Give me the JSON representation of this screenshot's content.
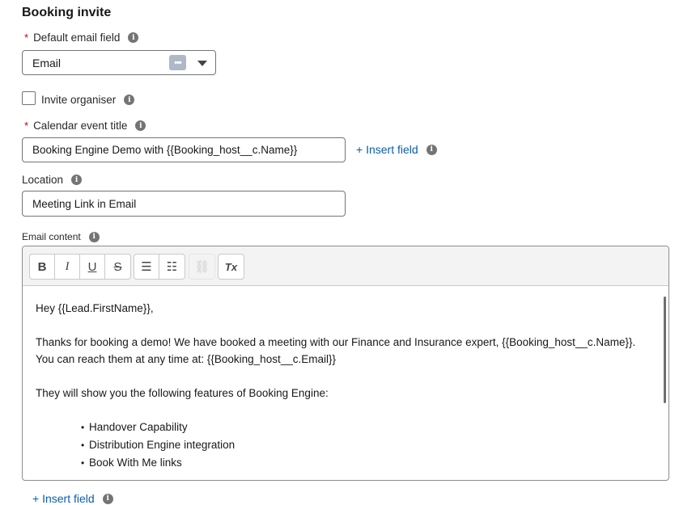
{
  "section": {
    "title": "Booking invite"
  },
  "default_email": {
    "required_marker": "*",
    "label": "Default email field",
    "value": "Email",
    "dots_icon": "•••"
  },
  "invite_organiser": {
    "label": "Invite organiser",
    "checked": false
  },
  "calendar_title": {
    "required_marker": "*",
    "label": "Calendar event title",
    "value": "Booking Engine Demo with {{Booking_host__c.Name}}",
    "insert_field": "+ Insert field"
  },
  "location": {
    "label": "Location",
    "value": "Meeting Link in Email"
  },
  "email_content": {
    "label": "Email content",
    "toolbar": {
      "bold": "B",
      "italic": "I",
      "underline": "U",
      "strike": "S",
      "bullets": "☰",
      "numbered": "☷",
      "link": "⛓",
      "clear": "Tx"
    },
    "lines": {
      "greeting": "Hey {{Lead.FirstName}},",
      "line1": "Thanks for booking a demo! We have booked a meeting with our Finance and Insurance expert, {{Booking_host__c.Name}}.",
      "line2": "You can reach them at any time at: {{Booking_host__c.Email}}",
      "line3": "They will show you the following features of Booking Engine:"
    },
    "bullets": [
      "Handover Capability",
      "Distribution Engine integration",
      "Book With Me links"
    ],
    "insert_field": "+ Insert field"
  },
  "info_icon": "i"
}
